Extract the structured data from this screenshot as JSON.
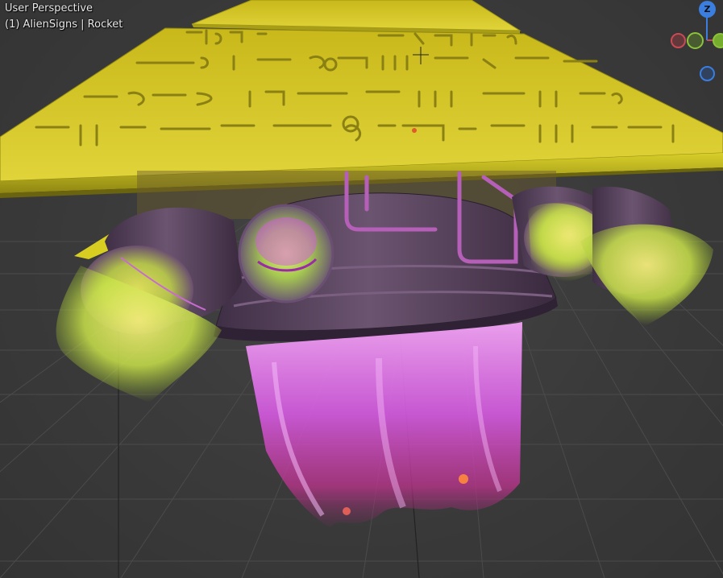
{
  "viewport": {
    "view_name": "User Perspective",
    "object_info": "(1) AlienSigns | Rocket"
  },
  "gizmo": {
    "z_label": "Z",
    "colors": {
      "x": "#c84a55",
      "y": "#8cc33a",
      "z": "#3a7ee0"
    }
  },
  "colors": {
    "viewport_bg": "#393939",
    "grid": "#4a4a4a",
    "pyramid": "#d9cc1f",
    "engine_body": "#4f3b52",
    "magenta_flame": "#e05ae8",
    "lime_flame": "#c8e64a",
    "pipes": "#b85cba"
  }
}
